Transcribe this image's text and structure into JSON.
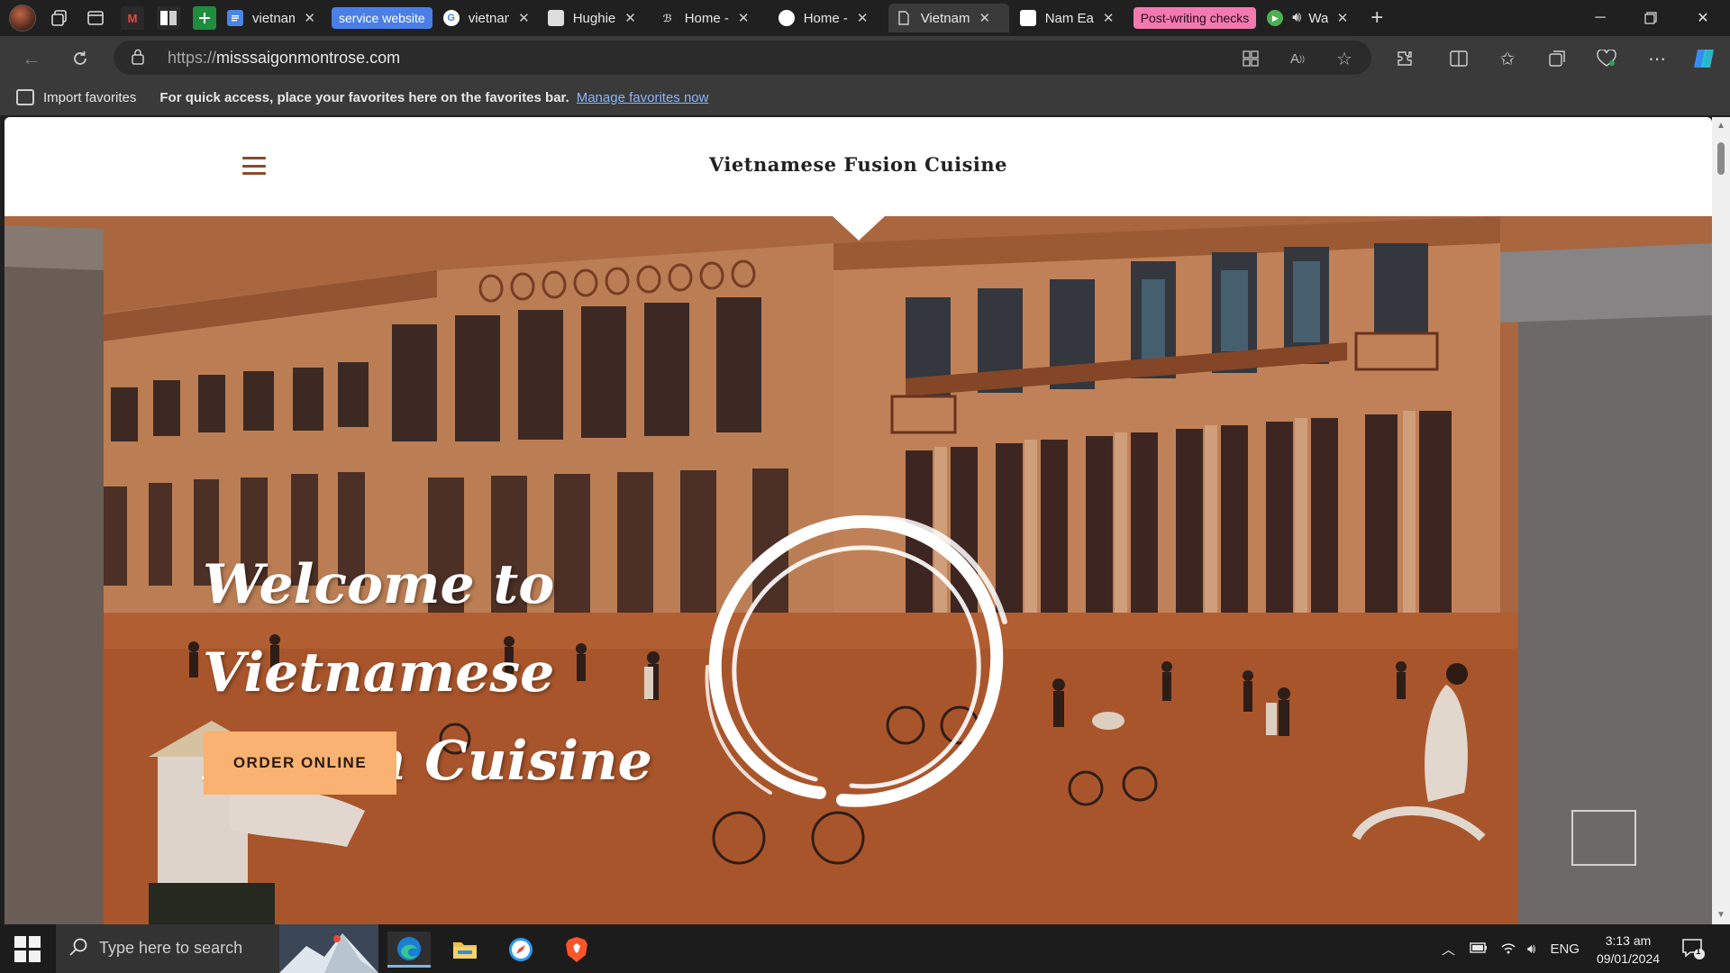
{
  "tabs": [
    {
      "label": "vietnam",
      "favicon_color": "#4a86e8",
      "favicon": "docs-icon"
    },
    {
      "label": "vietnam",
      "favicon_color": "#ffffff",
      "favicon": "google-icon"
    },
    {
      "label": "Hughie",
      "favicon_color": "#dddddd",
      "favicon": "site-icon"
    },
    {
      "label": "Home -",
      "favicon_color": "#cfcfcf",
      "favicon": "script-icon"
    },
    {
      "label": "Home -",
      "favicon_color": "#ffffff",
      "favicon": "site-icon"
    },
    {
      "label": "Vietnam",
      "favicon_color": "#cfcfcf",
      "favicon": "page-icon",
      "active": true
    },
    {
      "label": "Nam Ea",
      "favicon_color": "#ffffff",
      "favicon": "site-icon"
    },
    {
      "label": "Wa",
      "favicon_color": "#4caf50",
      "favicon": "play-icon"
    }
  ],
  "tab_groups": {
    "service": {
      "label": "service website",
      "color": "#4a7fe8"
    },
    "checks": {
      "label": "Post-writing checks",
      "color": "#f27ab0"
    }
  },
  "address_bar": {
    "protocol": "https://",
    "domain": "misssaigonmontrose.com"
  },
  "favorites_bar": {
    "import_label": "Import favorites",
    "message": "For quick access, place your favorites here on the favorites bar.",
    "link": "Manage favorites now"
  },
  "site": {
    "title": "Vietnamese Fusion Cuisine",
    "hero_line1": "Welcome to Vietnamese",
    "hero_line2": "Fusion Cuisine",
    "cta": "ORDER ONLINE",
    "accent": "#f9b271",
    "menu_color": "#8a4a2a"
  },
  "taskbar": {
    "search_placeholder": "Type here to search",
    "language": "ENG",
    "time": "3:13 am",
    "date": "09/01/2024",
    "notification_count": "1"
  }
}
